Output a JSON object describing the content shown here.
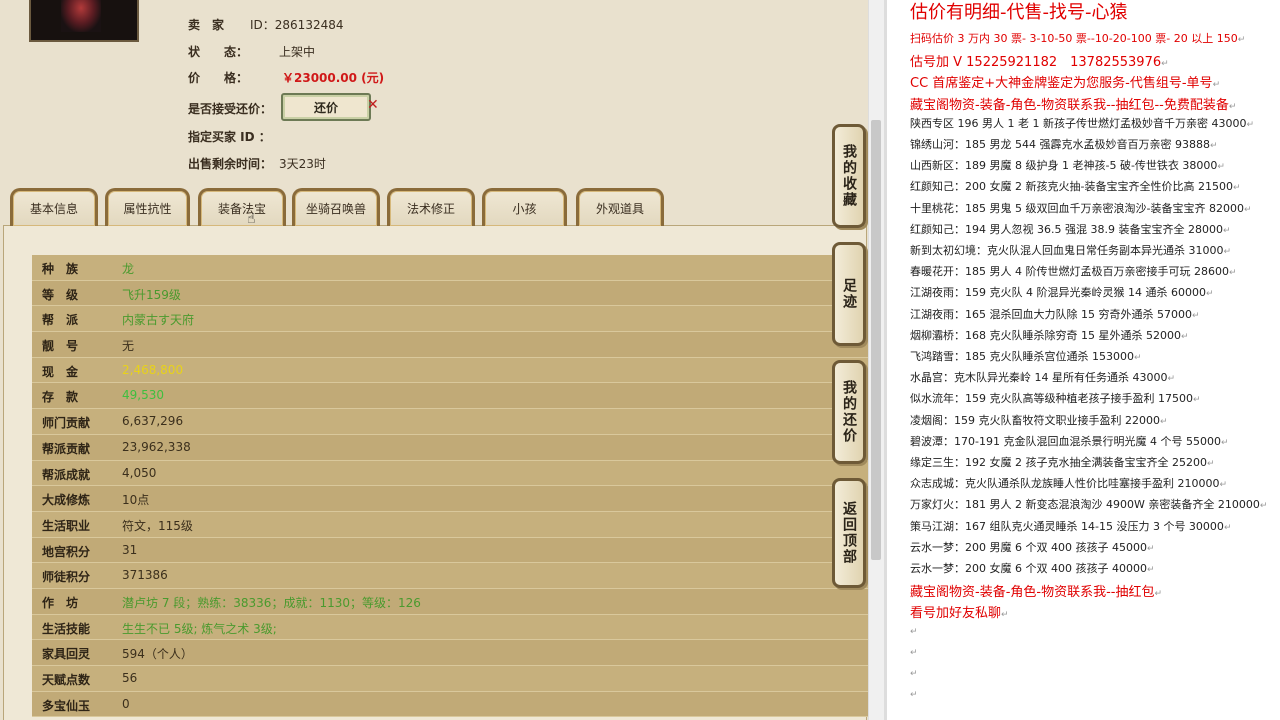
{
  "listing": {
    "seller_label": "卖　家",
    "seller_value": "ID：286132484",
    "status_label": "状　　态：",
    "status_value": "上架中",
    "price_label": "价　　格：",
    "price_value": "￥23000.00 (元)",
    "counter_label": "是否接受还价：",
    "counter_button": "还价",
    "buyer_label": "指定买家 ID ：",
    "buyer_value": "",
    "remaining_label": "出售剩余时间：",
    "remaining_value": "3天23时"
  },
  "tabs": [
    "基本信息",
    "属性抗性",
    "装备法宝",
    "坐骑召唤兽",
    "法术修正",
    "小孩",
    "外观道具"
  ],
  "active_tab": "装备法宝",
  "side_tabs": [
    "我的收藏",
    "足迹",
    "我的还价",
    "返回顶部"
  ],
  "rows": [
    {
      "k": "种　族",
      "v": "龙"
    },
    {
      "k": "等　级",
      "v": "飞升159级"
    },
    {
      "k": "帮　派",
      "v": "内蒙古す天府"
    },
    {
      "k": "靓　号",
      "v": "无"
    },
    {
      "k": "现　金",
      "v": "2,468,800"
    },
    {
      "k": "存　款",
      "v": "49,530"
    },
    {
      "k": "师门贡献",
      "v": "6,637,296"
    },
    {
      "k": "帮派贡献",
      "v": "23,962,338"
    },
    {
      "k": "帮派成就",
      "v": "4,050"
    },
    {
      "k": "大成修炼",
      "v": "10点"
    },
    {
      "k": "生活职业",
      "v": "符文，115级"
    },
    {
      "k": "地宫积分",
      "v": "31"
    },
    {
      "k": "师徒积分",
      "v": "371386"
    },
    {
      "k": "作　坊",
      "v": "潜卢坊 7 段；熟练：38336；成就：1130；等级：126"
    },
    {
      "k": "生活技能",
      "v": "生生不已 5级; 炼气之术 3级;"
    },
    {
      "k": "家具回灵",
      "v": "594（个人）"
    },
    {
      "k": "天赋点数",
      "v": "56"
    },
    {
      "k": "多宝仙玉",
      "v": "0"
    }
  ],
  "colors": {
    "green": "#4a9a2e",
    "yellow": "#e8d21a",
    "cash_green": "#3fbf3f",
    "red": "#e00000"
  },
  "notes": [
    {
      "t": "估价有明细-代售-找号-心猿",
      "c": "big"
    },
    {
      "t": "扫码估价 3 万内 30 票- 3-10-50 票--10-20-100 票- 20 以上 150",
      "c": "red"
    },
    {
      "t": "估号加 V 15225921182　13782553976",
      "c": "red",
      "s": 13
    },
    {
      "t": "CC 首席鉴定+大神金牌鉴定为您服务-代售组号-单号",
      "c": "red",
      "s": 13
    },
    {
      "t": "藏宝阁物资-装备-角色-物资联系我--抽红包--免费配装备",
      "c": "red",
      "s": 13
    },
    {
      "t": "陕西专区 196 男人 1 老 1 新孩子传世燃灯孟极妙音千万亲密 43000",
      "c": ""
    },
    {
      "t": "锦绣山河：185 男龙 544 强霹克水孟极妙音百万亲密 93888",
      "c": ""
    },
    {
      "t": "山西新区：189 男魔 8 级护身 1 老神孩-5 破-传世铁衣 38000",
      "c": ""
    },
    {
      "t": "红颜知己：200 女魔 2 新孩克火抽-装备宝宝齐全性价比高 21500",
      "c": ""
    },
    {
      "t": "十里桃花：185 男鬼 5 级双回血千万亲密浪淘沙-装备宝宝齐 82000",
      "c": ""
    },
    {
      "t": "红颜知己：194 男人忽视 36.5 强混 38.9 装备宝宝齐全 28000",
      "c": ""
    },
    {
      "t": "新到太初幻境：克火队混人回血鬼日常任务副本异光通杀 31000",
      "c": ""
    },
    {
      "t": "春暖花开：185 男人 4 阶传世燃灯孟极百万亲密接手可玩 28600",
      "c": ""
    },
    {
      "t": "江湖夜雨：159 克火队 4 阶混异光秦岭灵猴 14 通杀 60000",
      "c": ""
    },
    {
      "t": "江湖夜雨：165 混杀回血大力队除 15 穷奇外通杀 57000",
      "c": ""
    },
    {
      "t": "烟柳灞桥：168 克火队睡杀除穷奇 15 星外通杀 52000",
      "c": ""
    },
    {
      "t": "飞鸿踏雪：185 克火队睡杀宫位通杀 153000",
      "c": ""
    },
    {
      "t": "水晶宫：克木队异光秦岭 14 星所有任务通杀 43000",
      "c": ""
    },
    {
      "t": "似水流年：159 克火队高等级种植老孩子接手盈利 17500",
      "c": ""
    },
    {
      "t": "凌烟阁：159 克火队畜牧符文职业接手盈利 22000",
      "c": ""
    },
    {
      "t": "碧波潭：170-191 克金队混回血混杀景行明光魔 4 个号 55000",
      "c": ""
    },
    {
      "t": "缘定三生：192 女魔 2 孩子克水抽全满装备宝宝齐全 25200",
      "c": ""
    },
    {
      "t": "众志成城：克火队通杀队龙族睡人性价比哇塞接手盈利 210000",
      "c": ""
    },
    {
      "t": "万家灯火：181 男人 2 新变态混浪淘沙 4900W 亲密装备齐全 210000",
      "c": ""
    },
    {
      "t": "策马江湖：167 组队克火通灵睡杀 14-15 没压力 3 个号 30000",
      "c": ""
    },
    {
      "t": "云水一梦：200 男魔 6 个双 400 孩孩子 45000",
      "c": ""
    },
    {
      "t": "云水一梦：200 女魔 6 个双 400 孩孩子 40000",
      "c": ""
    },
    {
      "t": "藏宝阁物资-装备-角色-物资联系我--抽红包",
      "c": "red",
      "s": 13
    },
    {
      "t": "看号加好友私聊",
      "c": "red",
      "s": 13
    },
    {
      "t": "",
      "c": ""
    },
    {
      "t": "",
      "c": ""
    },
    {
      "t": "",
      "c": ""
    },
    {
      "t": "",
      "c": ""
    }
  ]
}
